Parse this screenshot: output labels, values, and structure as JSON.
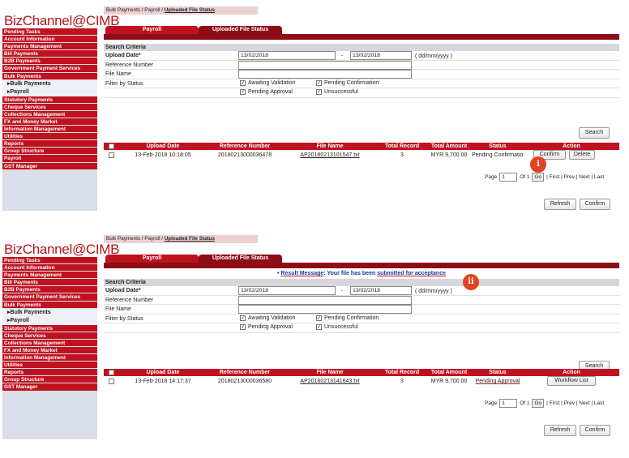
{
  "brand": "BizChannel@CIMB",
  "panels": [
    {
      "sidebar": [
        "Pending Tasks",
        "Account Information",
        "Payments Management",
        "Bill Payments",
        "B2B Payments",
        "Government Payment Services",
        "Bulk Payments",
        "▸Bulk Payments",
        "▸Payroll",
        "Statutory Payments",
        "Cheque Services",
        "Collections Management",
        "FX and Money Market",
        "Information Management",
        "Utilities",
        "Reports",
        "Group Structure",
        "Payroll",
        "GST Manager"
      ],
      "result_message": "",
      "row": {
        "date": "13-Feb-2018 10:18:05",
        "ref": "20180213000036478",
        "file": "AP20180213101547.txt",
        "total": "3",
        "amount": "MYR 9,700.00",
        "status": "Pending Confirmation"
      },
      "actions": [
        "Confirm",
        "Delete"
      ],
      "badge": "i"
    },
    {
      "sidebar": [
        "Pending Tasks",
        "Account Information",
        "Payments Management",
        "Bill Payments",
        "B2B Payments",
        "Government Payment Services",
        "Bulk Payments",
        "▸Bulk Payments",
        "▸Payroll",
        "Statutory Payments",
        "Cheque Services",
        "Collections Management",
        "FX and Money Market",
        "Information Management",
        "Utilities",
        "Reports",
        "Group Structure",
        "GST Manager"
      ],
      "result_message_pre": "• ",
      "result_message_a": "Result Message",
      "result_message_b": ": Your file has been ",
      "result_message_c": "submitted for acceptance",
      "row": {
        "date": "13-Feb-2018 14:17:37",
        "ref": "20180213000036580",
        "file": "AP20180213141643.txt",
        "total": "3",
        "amount": "MYR 9,700.00",
        "status": "Pending Approval"
      },
      "actions": [
        "Workflow List"
      ],
      "badge": "ii"
    }
  ],
  "crumb": {
    "a": "Bulk Payments",
    "sep": "/",
    "b": "Payroll",
    "c": "Uploaded File Status"
  },
  "tabs": {
    "payroll": "Payroll",
    "status": "Uploaded File Status"
  },
  "criteria": {
    "title": "Search Criteria",
    "upload_date_label": "Upload Date*",
    "date_from": "13/02/2018",
    "date_sep": "-",
    "date_to": "13/02/2018",
    "date_hint": "( dd/mm/yyyy )",
    "ref_label": "Reference Number",
    "file_label": "File Name",
    "filter_label": "Filter by Status",
    "f1": "Awaiting Validation",
    "f2": "Pending Confirmation",
    "f3": "Pending Approval",
    "f4": "Unsuccessful"
  },
  "search_btn": "Search",
  "columns": {
    "date": "Upload Date",
    "ref": "Reference Number",
    "file": "File Name",
    "total": "Total Record",
    "amount": "Total Amount",
    "status": "Status",
    "action": "Action"
  },
  "paging": {
    "page": "Page",
    "value": "1",
    "of": "Of 1",
    "go": "Go",
    "links": "| First | Prev | Next | Last"
  },
  "footer": {
    "refresh": "Refresh",
    "confirm": "Confirm"
  },
  "colors": {
    "brand_red": "#c0111f",
    "dark_red": "#8e0c16",
    "badge": "#e3421f"
  }
}
